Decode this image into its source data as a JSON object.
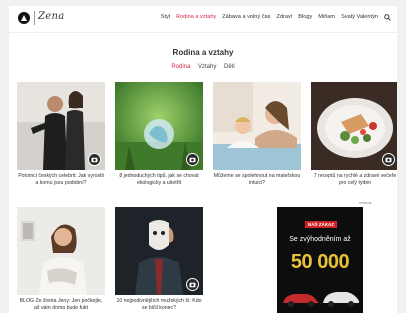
{
  "header": {
    "logo_text": "Zena",
    "nav": [
      {
        "label": "Styl",
        "active": false
      },
      {
        "label": "Rodina a vztahy",
        "active": true
      },
      {
        "label": "Zábava a volný čas",
        "active": false
      },
      {
        "label": "Zdraví",
        "active": false
      },
      {
        "label": "Blogy",
        "active": false
      },
      {
        "label": "Miňam",
        "active": false
      },
      {
        "label": "Svatý Valentýn",
        "active": false
      }
    ]
  },
  "main": {
    "title": "Rodina a vztahy",
    "subtabs": [
      {
        "label": "Rodina",
        "active": true
      },
      {
        "label": "Vztahy",
        "active": false
      },
      {
        "label": "Děti",
        "active": false
      }
    ],
    "cards": [
      {
        "caption": "Potomci českých celebrit: Jak vyrostli a komu jsou podobní?"
      },
      {
        "caption": "8 jednoduchých tipů, jak se chovat ekologicky a ušetřit"
      },
      {
        "caption": "Můžeme se spolehnout na mateřskou intuici?"
      },
      {
        "caption": "7 receptů na rychlé a zdravé večeře pro celý týden"
      },
      {
        "caption": "BLOG Ze života Jeny: Jen počkejte, až vám doma bude fukt"
      },
      {
        "caption": "10 nejpodivnějších mužských ší: Kdo se bičil konec?"
      }
    ]
  },
  "ad": {
    "small_label": "reklama",
    "badge": "NÁŠ ZÁKAZ",
    "line": "Se zvýhodněním až",
    "big": "50 000"
  }
}
